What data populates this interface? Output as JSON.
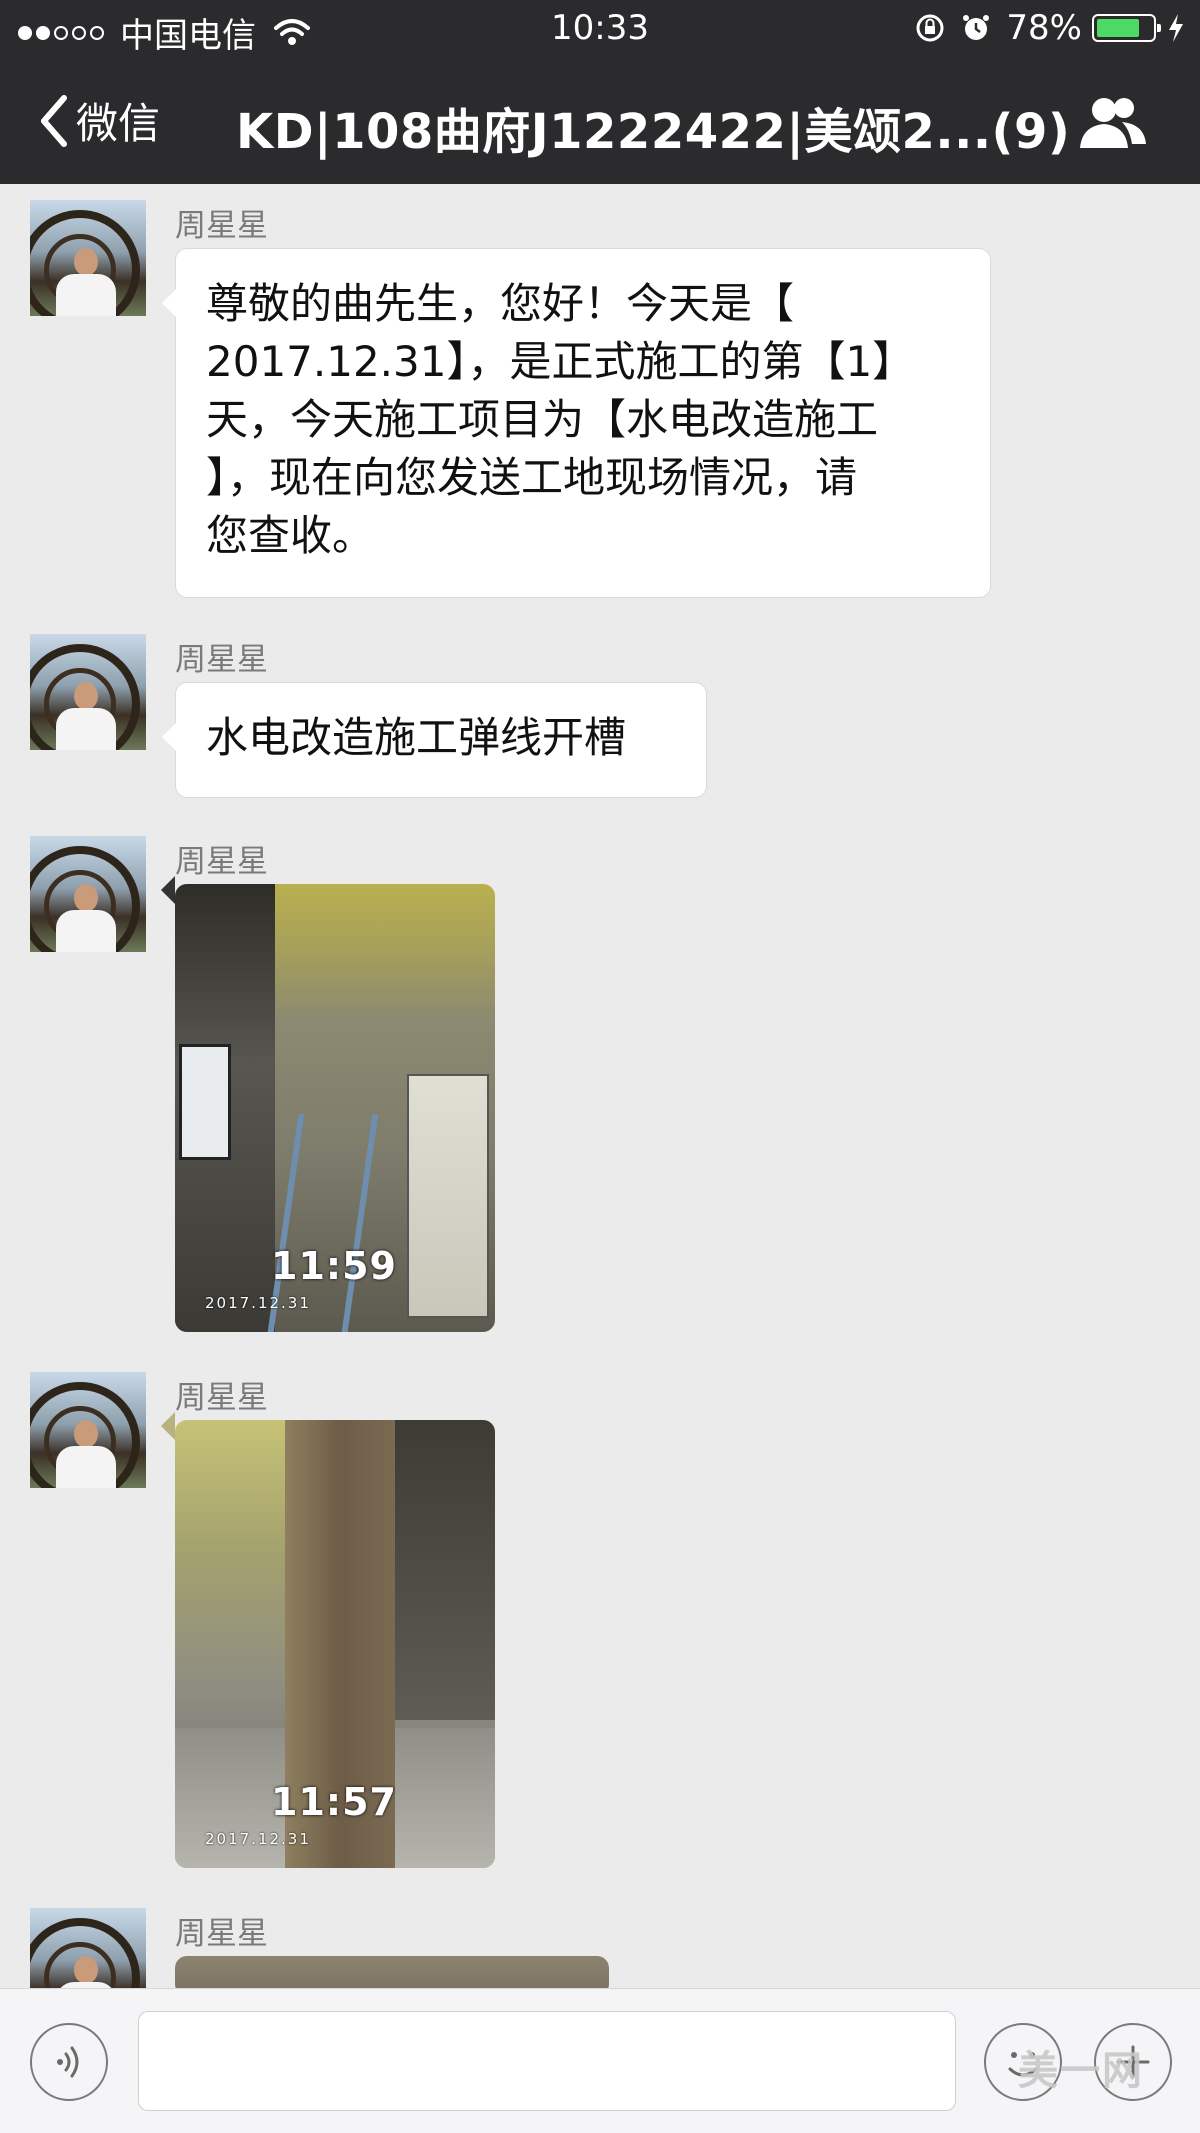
{
  "status_bar": {
    "carrier": "中国电信",
    "time": "10:33",
    "battery": "78%",
    "battery_level": 0.78,
    "signal_bars_filled": 2,
    "signal_bars_total": 5
  },
  "nav": {
    "back_label": "微信",
    "title": "KD|108曲府J1222422|美颂2...(9)"
  },
  "messages": [
    {
      "sender": "周星星",
      "type": "text",
      "text": "尊敬的曲先生，您好！今天是【\n2017.12.31】，是正式施工的第【1】\n天，今天施工项目为【水电改造施工\n】，现在向您发送工地现场情况，请\n您查收。"
    },
    {
      "sender": "周星星",
      "type": "text",
      "text": "水电改造施工弹线开槽"
    },
    {
      "sender": "周星星",
      "type": "image",
      "photo_time": "11:59",
      "photo_date": "2017.12.31"
    },
    {
      "sender": "周星星",
      "type": "image",
      "photo_time": "11:57",
      "photo_date": "2017.12.31"
    },
    {
      "sender": "周星星",
      "type": "image"
    }
  ],
  "input": {
    "placeholder": ""
  },
  "watermark": "美一网",
  "colors": {
    "nav_bg": "#2b2b2e",
    "chat_bg": "#ebebeb",
    "battery_fill": "#4cd964"
  }
}
